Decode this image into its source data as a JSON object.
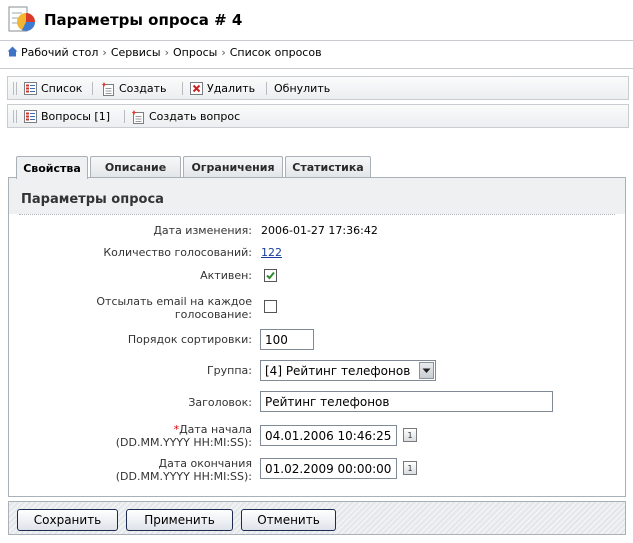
{
  "header": {
    "title": "Параметры опроса # 4"
  },
  "breadcrumb": {
    "items": [
      "Рабочий стол",
      "Сервисы",
      "Опросы",
      "Список опросов"
    ],
    "separator": "›"
  },
  "toolbar1": {
    "list": "Список",
    "create": "Создать",
    "delete": "Удалить",
    "reset": "Обнулить"
  },
  "toolbar2": {
    "questions": "Вопросы [1]",
    "create_question": "Создать вопрос"
  },
  "tabs": [
    "Свойства",
    "Описание",
    "Ограничения",
    "Статистика"
  ],
  "form": {
    "title": "Параметры опроса",
    "modified_label": "Дата изменения:",
    "modified_value": "2006-01-27 17:36:42",
    "votes_label": "Количество голосований:",
    "votes_value": "122",
    "active_label": "Активен:",
    "active_checked": true,
    "email_label_1": "Отсылать email на каждое",
    "email_label_2": "голосование:",
    "email_checked": false,
    "sort_label": "Порядок сортировки:",
    "sort_value": "100",
    "group_label": "Группа:",
    "group_value": "[4] Рейтинг телефонов",
    "caption_label": "Заголовок:",
    "caption_value": "Рейтинг телефонов",
    "start_label": "Дата начала",
    "start_required": "*",
    "start_format": "(DD.MM.YYYY HH:MI:SS):",
    "start_value": "04.01.2006 10:46:25",
    "end_label": "Дата окончания",
    "end_format": "(DD.MM.YYYY HH:MI:SS):",
    "end_value": "01.02.2009 00:00:00",
    "calendar_glyph": "1"
  },
  "buttons": {
    "save": "Сохранить",
    "apply": "Применить",
    "cancel": "Отменить"
  },
  "colors": {
    "link": "#1a3d9c",
    "required": "#dd0000",
    "check": "#2e8b2e",
    "delete": "#cc2222"
  }
}
